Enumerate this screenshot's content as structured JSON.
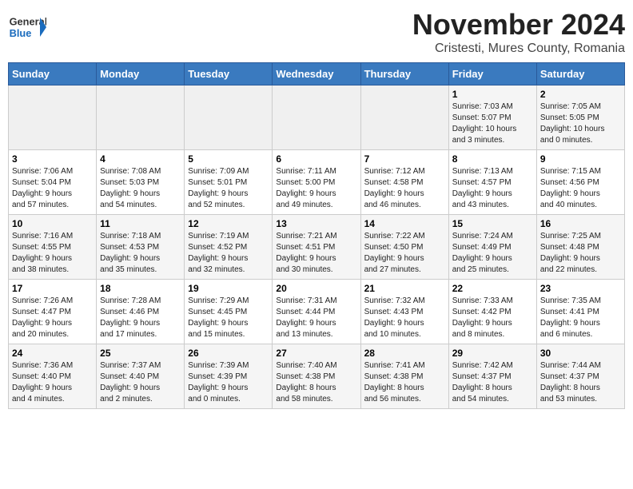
{
  "header": {
    "logo_general": "General",
    "logo_blue": "Blue",
    "month_title": "November 2024",
    "location": "Cristesti, Mures County, Romania"
  },
  "days_of_week": [
    "Sunday",
    "Monday",
    "Tuesday",
    "Wednesday",
    "Thursday",
    "Friday",
    "Saturday"
  ],
  "weeks": [
    [
      {
        "day": "",
        "info": ""
      },
      {
        "day": "",
        "info": ""
      },
      {
        "day": "",
        "info": ""
      },
      {
        "day": "",
        "info": ""
      },
      {
        "day": "",
        "info": ""
      },
      {
        "day": "1",
        "info": "Sunrise: 7:03 AM\nSunset: 5:07 PM\nDaylight: 10 hours\nand 3 minutes."
      },
      {
        "day": "2",
        "info": "Sunrise: 7:05 AM\nSunset: 5:05 PM\nDaylight: 10 hours\nand 0 minutes."
      }
    ],
    [
      {
        "day": "3",
        "info": "Sunrise: 7:06 AM\nSunset: 5:04 PM\nDaylight: 9 hours\nand 57 minutes."
      },
      {
        "day": "4",
        "info": "Sunrise: 7:08 AM\nSunset: 5:03 PM\nDaylight: 9 hours\nand 54 minutes."
      },
      {
        "day": "5",
        "info": "Sunrise: 7:09 AM\nSunset: 5:01 PM\nDaylight: 9 hours\nand 52 minutes."
      },
      {
        "day": "6",
        "info": "Sunrise: 7:11 AM\nSunset: 5:00 PM\nDaylight: 9 hours\nand 49 minutes."
      },
      {
        "day": "7",
        "info": "Sunrise: 7:12 AM\nSunset: 4:58 PM\nDaylight: 9 hours\nand 46 minutes."
      },
      {
        "day": "8",
        "info": "Sunrise: 7:13 AM\nSunset: 4:57 PM\nDaylight: 9 hours\nand 43 minutes."
      },
      {
        "day": "9",
        "info": "Sunrise: 7:15 AM\nSunset: 4:56 PM\nDaylight: 9 hours\nand 40 minutes."
      }
    ],
    [
      {
        "day": "10",
        "info": "Sunrise: 7:16 AM\nSunset: 4:55 PM\nDaylight: 9 hours\nand 38 minutes."
      },
      {
        "day": "11",
        "info": "Sunrise: 7:18 AM\nSunset: 4:53 PM\nDaylight: 9 hours\nand 35 minutes."
      },
      {
        "day": "12",
        "info": "Sunrise: 7:19 AM\nSunset: 4:52 PM\nDaylight: 9 hours\nand 32 minutes."
      },
      {
        "day": "13",
        "info": "Sunrise: 7:21 AM\nSunset: 4:51 PM\nDaylight: 9 hours\nand 30 minutes."
      },
      {
        "day": "14",
        "info": "Sunrise: 7:22 AM\nSunset: 4:50 PM\nDaylight: 9 hours\nand 27 minutes."
      },
      {
        "day": "15",
        "info": "Sunrise: 7:24 AM\nSunset: 4:49 PM\nDaylight: 9 hours\nand 25 minutes."
      },
      {
        "day": "16",
        "info": "Sunrise: 7:25 AM\nSunset: 4:48 PM\nDaylight: 9 hours\nand 22 minutes."
      }
    ],
    [
      {
        "day": "17",
        "info": "Sunrise: 7:26 AM\nSunset: 4:47 PM\nDaylight: 9 hours\nand 20 minutes."
      },
      {
        "day": "18",
        "info": "Sunrise: 7:28 AM\nSunset: 4:46 PM\nDaylight: 9 hours\nand 17 minutes."
      },
      {
        "day": "19",
        "info": "Sunrise: 7:29 AM\nSunset: 4:45 PM\nDaylight: 9 hours\nand 15 minutes."
      },
      {
        "day": "20",
        "info": "Sunrise: 7:31 AM\nSunset: 4:44 PM\nDaylight: 9 hours\nand 13 minutes."
      },
      {
        "day": "21",
        "info": "Sunrise: 7:32 AM\nSunset: 4:43 PM\nDaylight: 9 hours\nand 10 minutes."
      },
      {
        "day": "22",
        "info": "Sunrise: 7:33 AM\nSunset: 4:42 PM\nDaylight: 9 hours\nand 8 minutes."
      },
      {
        "day": "23",
        "info": "Sunrise: 7:35 AM\nSunset: 4:41 PM\nDaylight: 9 hours\nand 6 minutes."
      }
    ],
    [
      {
        "day": "24",
        "info": "Sunrise: 7:36 AM\nSunset: 4:40 PM\nDaylight: 9 hours\nand 4 minutes."
      },
      {
        "day": "25",
        "info": "Sunrise: 7:37 AM\nSunset: 4:40 PM\nDaylight: 9 hours\nand 2 minutes."
      },
      {
        "day": "26",
        "info": "Sunrise: 7:39 AM\nSunset: 4:39 PM\nDaylight: 9 hours\nand 0 minutes."
      },
      {
        "day": "27",
        "info": "Sunrise: 7:40 AM\nSunset: 4:38 PM\nDaylight: 8 hours\nand 58 minutes."
      },
      {
        "day": "28",
        "info": "Sunrise: 7:41 AM\nSunset: 4:38 PM\nDaylight: 8 hours\nand 56 minutes."
      },
      {
        "day": "29",
        "info": "Sunrise: 7:42 AM\nSunset: 4:37 PM\nDaylight: 8 hours\nand 54 minutes."
      },
      {
        "day": "30",
        "info": "Sunrise: 7:44 AM\nSunset: 4:37 PM\nDaylight: 8 hours\nand 53 minutes."
      }
    ]
  ]
}
